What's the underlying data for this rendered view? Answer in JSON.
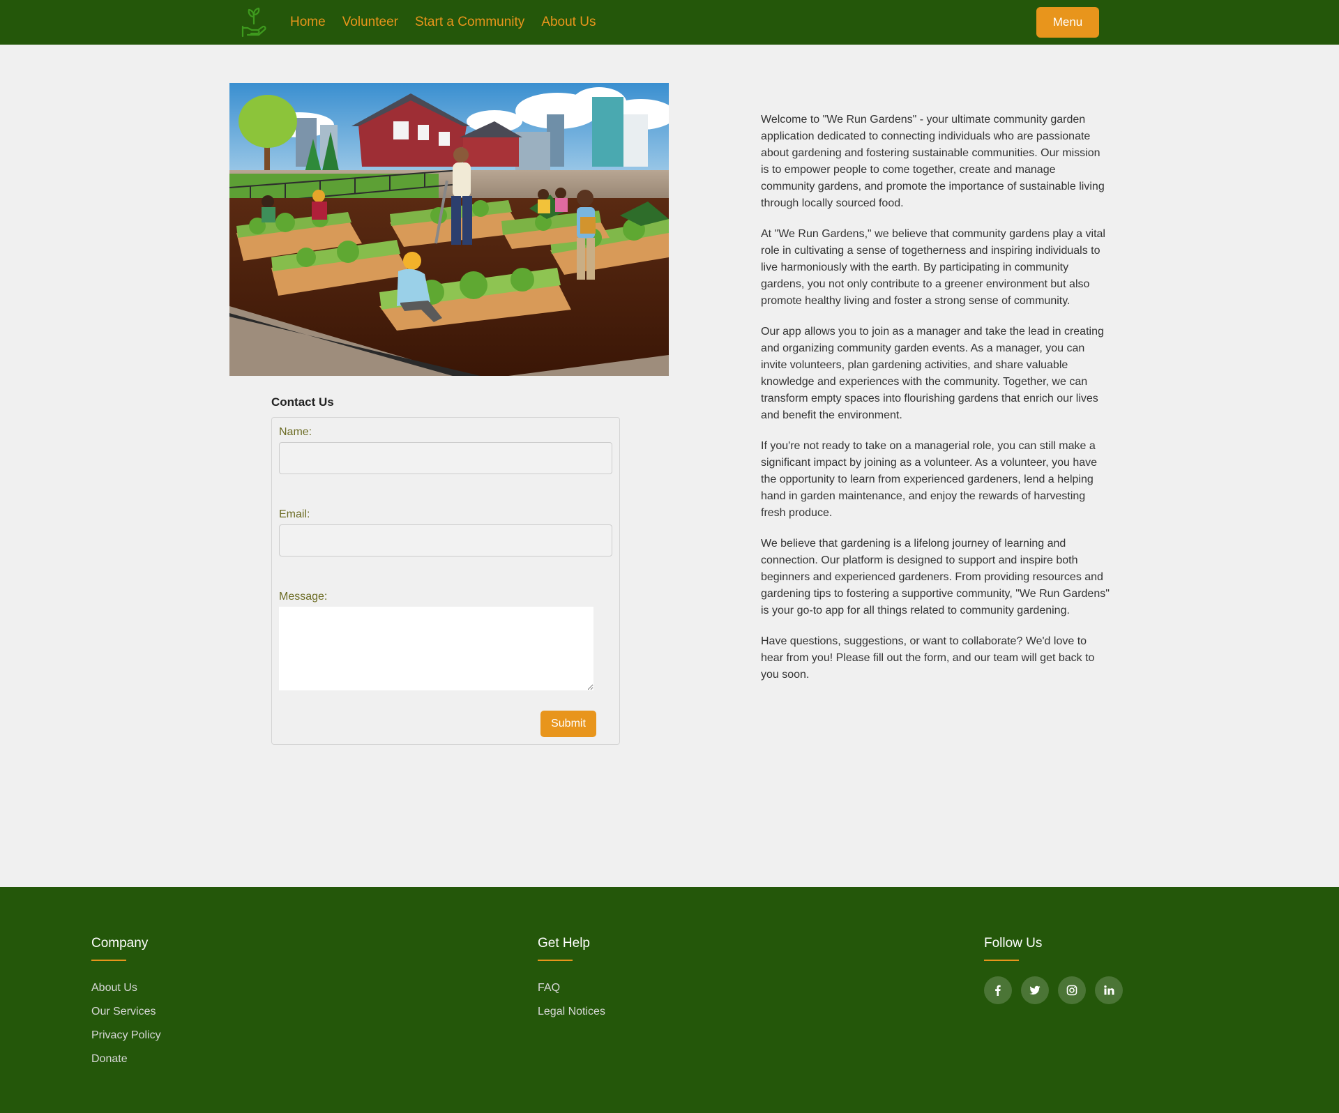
{
  "nav": {
    "links": [
      "Home",
      "Volunteer",
      "Start a Community",
      "About Us"
    ],
    "menu_label": "Menu"
  },
  "contact": {
    "title": "Contact Us",
    "name_label": "Name:",
    "email_label": "Email:",
    "message_label": "Message:",
    "name_value": "",
    "email_value": "",
    "message_value": "",
    "submit_label": "Submit"
  },
  "about": {
    "paragraphs": [
      "Welcome to \"We Run Gardens\" - your ultimate community garden application dedicated to connecting individuals who are passionate about gardening and fostering sustainable communities. Our mission is to empower people to come together, create and manage community gardens, and promote the importance of sustainable living through locally sourced food.",
      "At \"We Run Gardens,\" we believe that community gardens play a vital role in cultivating a sense of togetherness and inspiring individuals to live harmoniously with the earth. By participating in community gardens, you not only contribute to a greener environment but also promote healthy living and foster a strong sense of community.",
      "Our app allows you to join as a manager and take the lead in creating and organizing community garden events. As a manager, you can invite volunteers, plan gardening activities, and share valuable knowledge and experiences with the community. Together, we can transform empty spaces into flourishing gardens that enrich our lives and benefit the environment.",
      "If you're not ready to take on a managerial role, you can still make a significant impact by joining as a volunteer. As a volunteer, you have the opportunity to learn from experienced gardeners, lend a helping hand in garden maintenance, and enjoy the rewards of harvesting fresh produce.",
      "We believe that gardening is a lifelong journey of learning and connection. Our platform is designed to support and inspire both beginners and experienced gardeners. From providing resources and gardening tips to fostering a supportive community, \"We Run Gardens\" is your go-to app for all things related to community gardening.",
      "Have questions, suggestions, or want to collaborate? We'd love to hear from you! Please fill out the form, and our team will get back to you soon."
    ]
  },
  "footer": {
    "company": {
      "heading": "Company",
      "links": [
        "About Us",
        "Our Services",
        "Privacy Policy",
        "Donate"
      ]
    },
    "help": {
      "heading": "Get Help",
      "links": [
        "FAQ",
        "Legal Notices"
      ]
    },
    "follow": {
      "heading": "Follow Us",
      "icons": [
        "facebook-icon",
        "twitter-icon",
        "instagram-icon",
        "linkedin-icon"
      ]
    }
  },
  "colors": {
    "brand_green": "#24570a",
    "accent_orange": "#e8951c",
    "background": "#f0f0f0"
  }
}
